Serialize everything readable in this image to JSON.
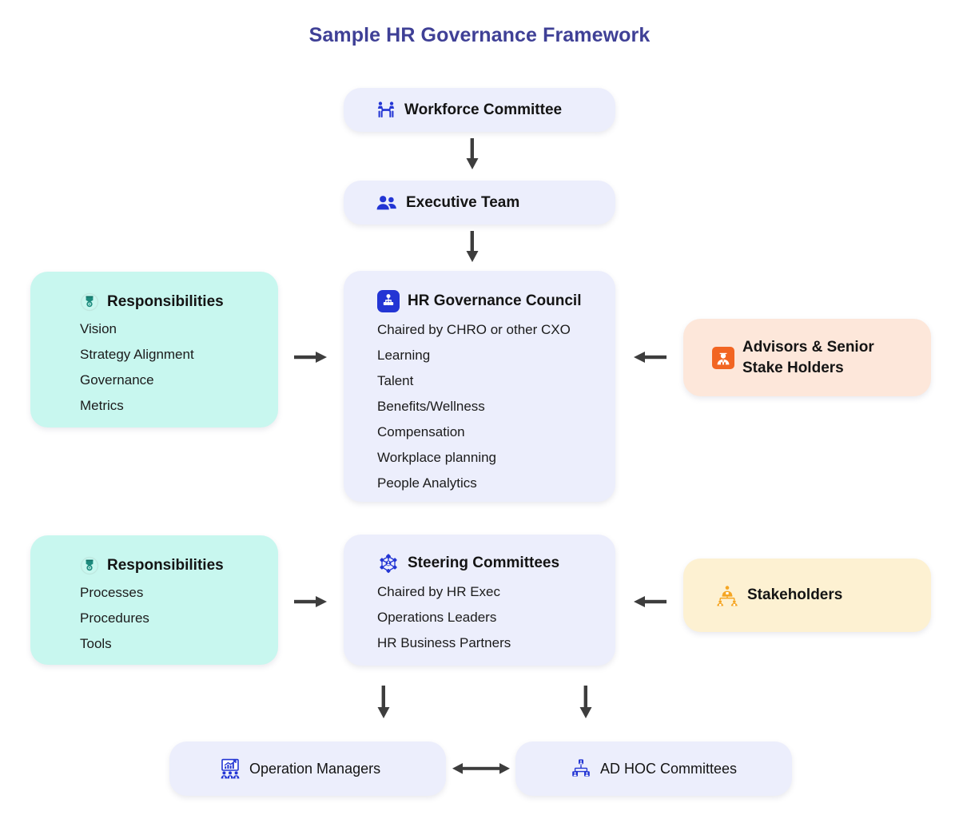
{
  "title": "Sample HR Governance Framework",
  "colors": {
    "title": "#3f4096",
    "lavender": "#eceefc",
    "mint": "#c8f7ef",
    "peach": "#fde7da",
    "cream": "#fdf1d2",
    "blue_icon": "#2335d4",
    "teal_icon": "#1d8a7d",
    "orange_icon": "#f26522",
    "amber_icon": "#f5a623",
    "arrow": "#3d3d3d"
  },
  "nodes": {
    "workforce_committee": {
      "label": "Workforce Committee",
      "icon": "teamwork-icon"
    },
    "executive_team": {
      "label": "Executive Team",
      "icon": "people-group-icon"
    },
    "responsibilities_top": {
      "label": "Responsibilities",
      "icon": "badge-icon",
      "items": [
        "Vision",
        "Strategy Alignment",
        "Governance",
        "Metrics"
      ]
    },
    "hr_governance_council": {
      "label": "HR Governance Council",
      "icon": "org-chart-icon",
      "items": [
        "Chaired by CHRO or other CXO",
        "Learning",
        "Talent",
        "Benefits/Wellness",
        "Compensation",
        "Workplace planning",
        "People Analytics"
      ]
    },
    "advisors": {
      "label_line1": "Advisors & Senior",
      "label_line2": "Stake Holders",
      "icon": "business-person-icon"
    },
    "responsibilities_bottom": {
      "label": "Responsibilities",
      "icon": "badge-icon",
      "items": [
        "Processes",
        "Procedures",
        "Tools"
      ]
    },
    "steering_committees": {
      "label": "Steering Committees",
      "icon": "network-hub-icon",
      "items": [
        "Chaired by HR Exec",
        "Operations Leaders",
        "HR Business Partners"
      ]
    },
    "stakeholders": {
      "label": "Stakeholders",
      "icon": "stakeholder-hierarchy-icon"
    },
    "operation_managers": {
      "label": "Operation Managers",
      "icon": "presentation-audience-icon"
    },
    "ad_hoc_committees": {
      "label": "AD HOC Committees",
      "icon": "team-structure-icon"
    }
  }
}
